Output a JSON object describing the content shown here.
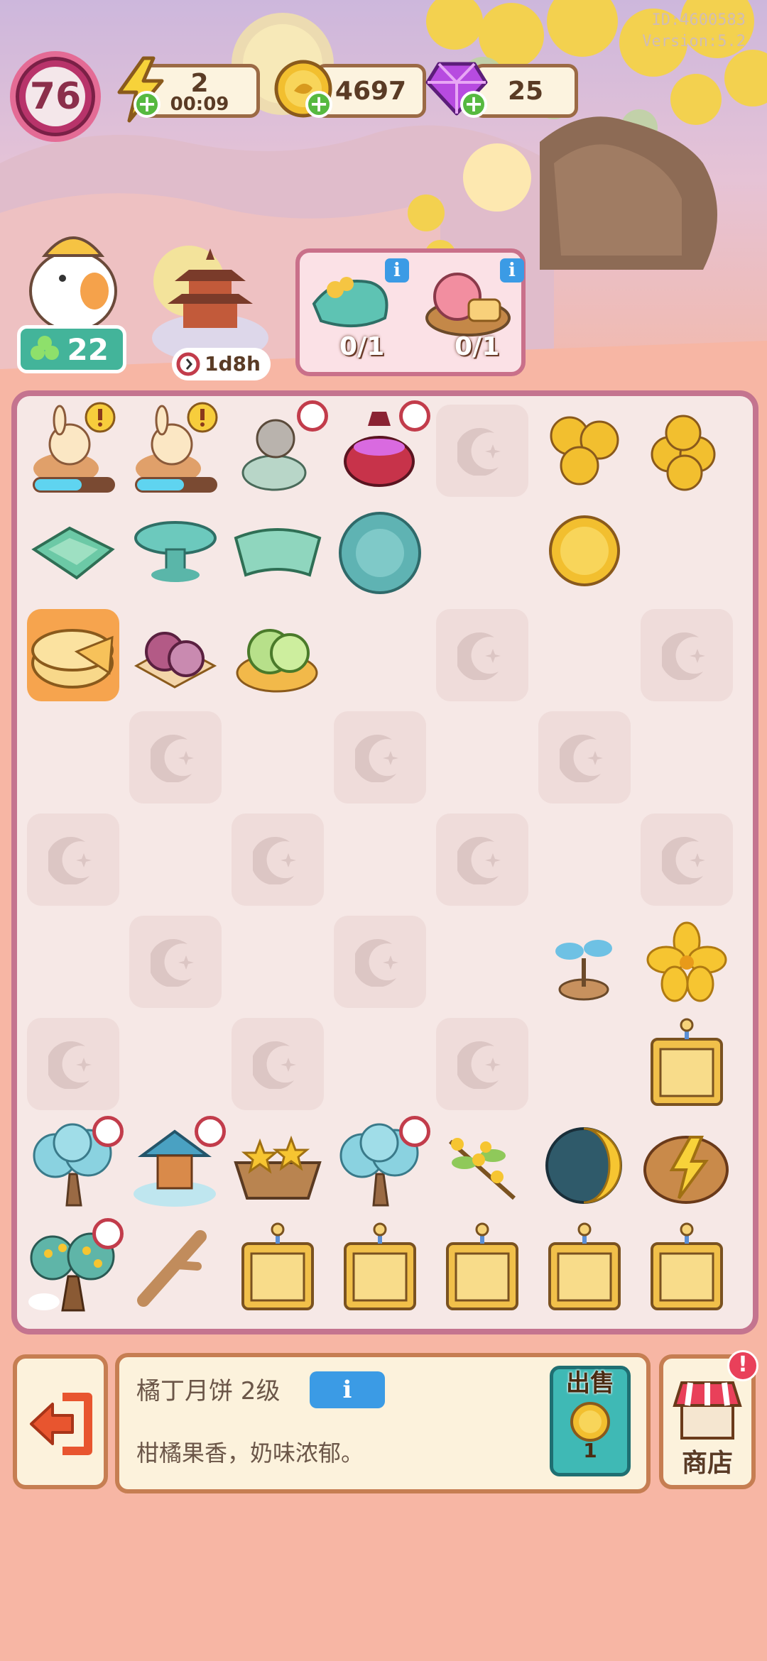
{
  "header": {
    "id_text": "ID:4600583",
    "version_text": "Version:5.2",
    "level": "76",
    "energy": {
      "value": "2",
      "timer": "00:09"
    },
    "coins": {
      "value": "4697"
    },
    "gems": {
      "value": "25"
    }
  },
  "upper": {
    "workers": "22",
    "event_timer": "1d8h",
    "orders": [
      {
        "count": "0/1",
        "icon": "jade-leaf-dish-icon"
      },
      {
        "count": "0/1",
        "icon": "mooncake-basket-icon"
      }
    ]
  },
  "bottom": {
    "item_name": "橘丁月饼 2级",
    "info_label": "i",
    "item_desc": "柑橘果香，奶味浓郁。",
    "sell_label": "出售",
    "sell_price": "1",
    "shop_label": "商店",
    "shop_badge": "!"
  },
  "colors": {
    "board_border": "#c4748f",
    "locked_cell": "#efdcda",
    "selected_cell": "#f6a44e",
    "accent_blue": "#3b9be5"
  }
}
